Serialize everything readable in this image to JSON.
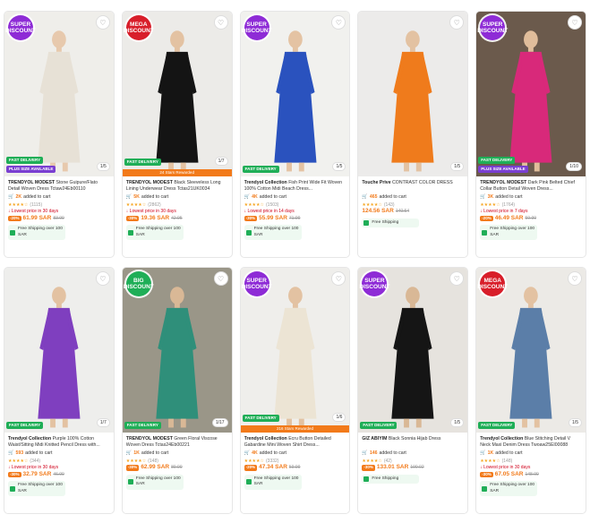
{
  "colors": {
    "accent": "#f27a1a",
    "fast_delivery": "#1fae57",
    "plus": "#7a3fd1",
    "super_badge": "#8e2bd6",
    "mega_badge": "#d81e2a",
    "big_badge": "#1fae57"
  },
  "products": [
    {
      "badge_line1": "SUPER",
      "badge_line2": "DISCOUNT",
      "badge_color": "#8e2bd6",
      "fast_label": "FAST DELIVERY",
      "plus_label": "PLUS SIZE AVAILABLE",
      "strip": "",
      "counter": "1/5",
      "brand": "TRENDYOL MODEST",
      "name": "Stone Guipure/Flato Detail Woven Dress Tctaw24Eb00110",
      "cart_count": "2K",
      "cart_text": "added to cart",
      "rating_count": "(1115)",
      "lowest": "Lowest price in 30 days",
      "discount": "-20%",
      "price": "61.99 SAR",
      "old_price": "83.99",
      "shipping": "Free Shipping over 100 SAR",
      "bg": "#efeeea",
      "dress": "#e7e1d6",
      "skin": "#e7c9ad"
    },
    {
      "badge_line1": "MEGA",
      "badge_line2": "DISCOUNT",
      "badge_color": "#d81e2a",
      "fast_label": "FAST DELIVERY",
      "plus_label": "",
      "strip": "24 Stars Rewarded",
      "counter": "1/7",
      "brand": "TRENDYOL MODEST",
      "name": "Black Sleeveless Long Lining Underwear Dress Tctas21UK0034",
      "cart_count": "5K",
      "cart_text": "added to cart",
      "rating_count": "(2862)",
      "lowest": "Lowest price in 30 days",
      "discount": "-30%",
      "price": "19.36 SAR",
      "old_price": "42.95",
      "shipping": "Free Shipping over 100 SAR",
      "bg": "#ecebe8",
      "dress": "#141414",
      "skin": "#e3c2a2"
    },
    {
      "badge_line1": "SUPER",
      "badge_line2": "DISCOUNT",
      "badge_color": "#8e2bd6",
      "fast_label": "FAST DELIVERY",
      "plus_label": "",
      "strip": "",
      "counter": "1/5",
      "brand": "Trendyol Collection",
      "name": "Fish Print Wide Fit Woven 100% Cotton Midi Beach Dress...",
      "cart_count": "4K",
      "cart_text": "added to cart",
      "rating_count": "(1503)",
      "lowest": "Lowest price in 14 days",
      "discount": "-30%",
      "price": "55.99 SAR",
      "old_price": "71.99",
      "shipping": "Free Shipping over 100 SAR",
      "bg": "#f1f1ee",
      "dress": "#2a52be",
      "skin": "#e4c3a3"
    },
    {
      "badge_line1": "",
      "badge_line2": "",
      "badge_color": "",
      "fast_label": "",
      "plus_label": "",
      "strip": "",
      "counter": "1/5",
      "brand": "Touche Prive",
      "name": "CONTRAST COLOR DRESS",
      "cart_count": "465",
      "cart_text": "added to cart",
      "rating_count": "(143)",
      "lowest": "",
      "discount": "",
      "price": "124.56 SAR",
      "old_price": "140.54",
      "shipping": "Free Shipping",
      "bg": "#ecebea",
      "dress": "#ef7b1c",
      "skin": "#e3c2a2"
    },
    {
      "badge_line1": "SUPER",
      "badge_line2": "DISCOUNT",
      "badge_color": "#8e2bd6",
      "fast_label": "FAST DELIVERY",
      "plus_label": "PLUS SIZE AVAILABLE",
      "strip": "",
      "counter": "1/10",
      "brand": "TRENDYOL MODEST",
      "name": "Dark Pink Belted Chief Collar Button Detail Woven Dress...",
      "cart_count": "3K",
      "cart_text": "added to cart",
      "rating_count": "(1764)",
      "lowest": "Lowest price in 7 days",
      "discount": "-20%",
      "price": "46.49 SAR",
      "old_price": "59.99",
      "shipping": "Free Shipping over 100 SAR",
      "bg": "#6b5a4c",
      "dress": "#d8297a",
      "skin": "#e0bd9b"
    },
    {
      "badge_line1": "",
      "badge_line2": "",
      "badge_color": "",
      "fast_label": "FAST DELIVERY",
      "plus_label": "",
      "strip": "",
      "counter": "1/7",
      "brand": "Trendyol Collection",
      "name": "Purple 100% Cotton Waist/Sitting Midi Knitted Pencil Dress with...",
      "cart_count": "593",
      "cart_text": "added to cart",
      "rating_count": "(344)",
      "lowest": "Lowest price in 30 days",
      "discount": "-30%",
      "price": "32.79 SAR",
      "old_price": "46.99",
      "shipping": "Free Shipping over 100 SAR",
      "bg": "#eeeeec",
      "dress": "#7f3fbf",
      "skin": "#e3c2a2"
    },
    {
      "badge_line1": "BIG",
      "badge_line2": "DISCOUNT",
      "badge_color": "#1fae57",
      "fast_label": "FAST DELIVERY",
      "plus_label": "",
      "strip": "",
      "counter": "1/17",
      "brand": "TRENDYOL MODEST",
      "name": "Green Floral Viscose Woven Dress Tctas24Eb00221",
      "cart_count": "1K",
      "cart_text": "added to cart",
      "rating_count": "(148)",
      "lowest": "",
      "discount": "-30%",
      "price": "62.99 SAR",
      "old_price": "89.99",
      "shipping": "Free Shipping over 100 SAR",
      "bg": "#9a9688",
      "dress": "#2f8f7a",
      "skin": "#d9b896"
    },
    {
      "badge_line1": "SUPER",
      "badge_line2": "DISCOUNT",
      "badge_color": "#8e2bd6",
      "fast_label": "FAST DELIVERY",
      "plus_label": "",
      "strip": "216 Stars Rewarded",
      "counter": "1/6",
      "brand": "Trendyol Collection",
      "name": "Ecru Button Detailed Gabardine Mini Woven Shirt Dress...",
      "cart_count": "4K",
      "cart_text": "added to cart",
      "rating_count": "(3332)",
      "lowest": "",
      "discount": "-20%",
      "price": "47.34 SAR",
      "old_price": "59.99",
      "shipping": "Free Shipping over 100 SAR",
      "bg": "#efeeeb",
      "dress": "#ece4d4",
      "skin": "#e3c2a2"
    },
    {
      "badge_line1": "SUPER",
      "badge_line2": "DISCOUNT",
      "badge_color": "#8e2bd6",
      "fast_label": "FAST DELIVERY",
      "plus_label": "",
      "strip": "",
      "counter": "1/5",
      "brand": "GIZ ABIYIM",
      "name": "Black Sonnia Hijab Dress",
      "cart_count": "146",
      "cart_text": "added to cart",
      "rating_count": "(42)",
      "lowest": "",
      "discount": "-30%",
      "price": "133.01 SAR",
      "old_price": "190.02",
      "shipping": "Free Shipping",
      "bg": "#e6e3de",
      "dress": "#151515",
      "skin": "#d9b896"
    },
    {
      "badge_line1": "MEGA",
      "badge_line2": "DISCOUNT",
      "badge_color": "#d81e2a",
      "fast_label": "FAST DELIVERY",
      "plus_label": "",
      "strip": "",
      "counter": "1/5",
      "brand": "Trendyol Collection",
      "name": "Blue Stitching Detail V Neck Maxi Denim Dress Twoaw25El00088",
      "cart_count": "1K",
      "cart_text": "added to cart",
      "rating_count": "(148)",
      "lowest": "Lowest price in 30 days",
      "discount": "-30%",
      "price": "67.05 SAR",
      "old_price": "148.99",
      "shipping": "Free Shipping over 100 SAR",
      "bg": "#eceae6",
      "dress": "#5b7ea8",
      "skin": "#e3c2a2"
    }
  ]
}
